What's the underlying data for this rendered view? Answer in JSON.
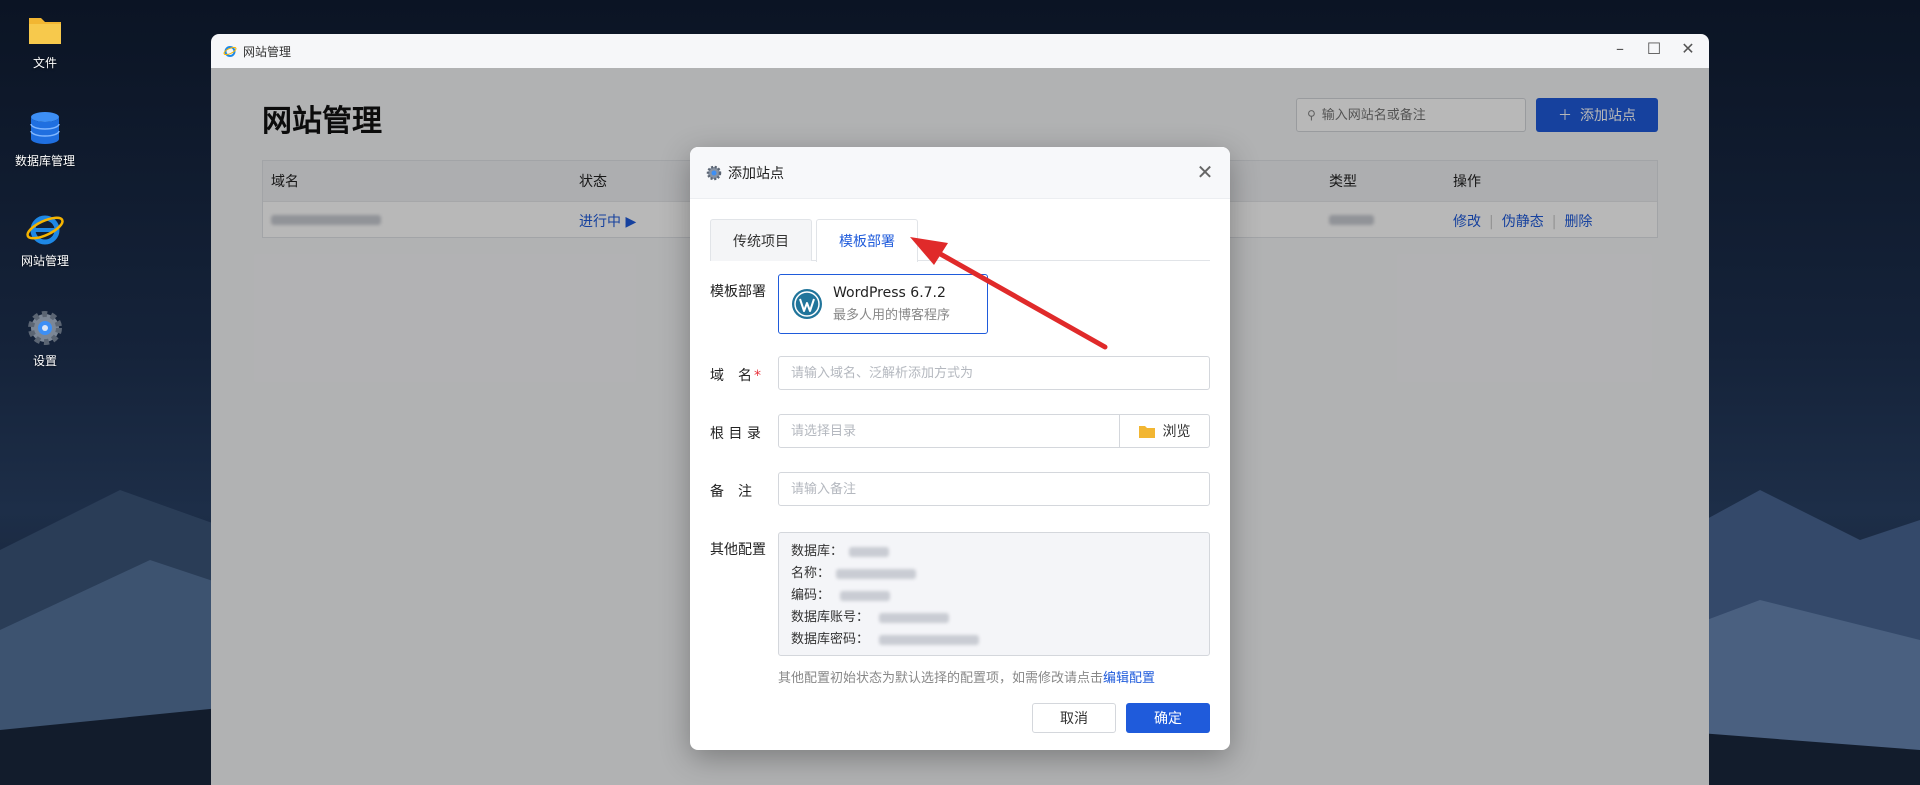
{
  "desktop": {
    "icons": [
      {
        "label": "文件",
        "icon": "folder-icon"
      },
      {
        "label": "数据库管理",
        "icon": "database-icon"
      },
      {
        "label": "网站管理",
        "icon": "ie-browser-icon"
      },
      {
        "label": "设置",
        "icon": "gear-icon"
      }
    ]
  },
  "window": {
    "title": "网站管理",
    "page_title": "网站管理",
    "search_placeholder": "输入网站名或备注",
    "add_site_label": "添加站点",
    "table": {
      "headers": {
        "domain": "域名",
        "status": "状态",
        "type": "类型",
        "actions": "操作"
      },
      "row": {
        "status": "进行中",
        "actions": [
          "修改",
          "伪静态",
          "删除"
        ]
      }
    }
  },
  "dialog": {
    "title": "添加站点",
    "tabs": [
      {
        "label": "传统项目",
        "active": false
      },
      {
        "label": "模板部署",
        "active": true
      }
    ],
    "template_label": "模板部署",
    "template": {
      "name": "WordPress 6.7.2",
      "desc": "最多人用的博客程序"
    },
    "domain_label": "域　名",
    "domain_placeholder": "请输入域名、泛解析添加方式为",
    "root_label": "根 目 录",
    "root_placeholder": "请选择目录",
    "browse_label": "浏览",
    "remark_label": "备　注",
    "remark_placeholder": "请输入备注",
    "other_label": "其他配置",
    "config": {
      "db": "数据库：",
      "name": "名称：",
      "encoding": "编码：",
      "account": "数据库账号：",
      "password": "数据库密码："
    },
    "hint_text": "其他配置初始状态为默认选择的配置项，如需修改请点击",
    "hint_link": "编辑配置",
    "cancel_label": "取消",
    "ok_label": "确定"
  },
  "colors": {
    "accent": "#1f5bdb",
    "required": "#e8323c",
    "annotation_arrow": "#e02a2a"
  }
}
